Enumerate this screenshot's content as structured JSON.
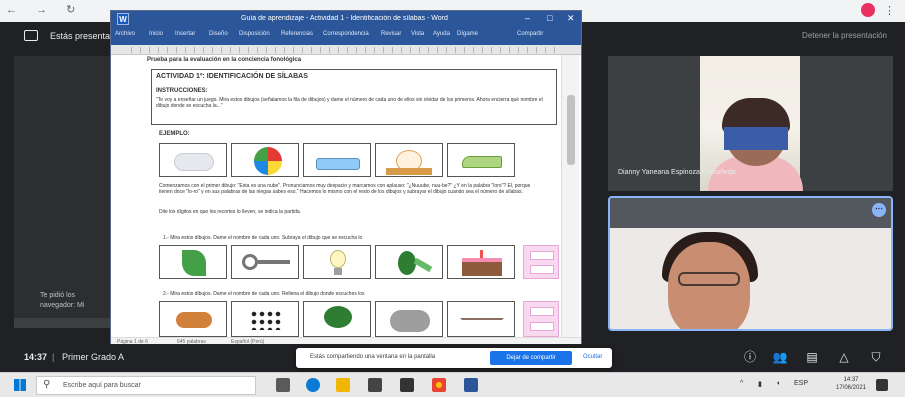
{
  "browser": {
    "nav_glyphs": "← → ↻",
    "menu_glyph": "⋮"
  },
  "meet_header": {
    "presenting_text": "Estás presentando",
    "stop_text": "Detener la presentación"
  },
  "left_captions": {
    "line1": "Te pidió los",
    "line2": "navegador: Mi"
  },
  "word": {
    "logo": "W",
    "title": "Guía de aprendizaje - Actividad 1 - Identificación de sílabas - Word",
    "ribbon_tabs": [
      "Archivo",
      "Inicio",
      "Insertar",
      "Diseño",
      "Disposición",
      "Referencias",
      "Correspondencia",
      "Revisar",
      "Vista",
      "Ayuda",
      "Dígame",
      "Compartir"
    ],
    "doc": {
      "heading": "Prueba para la evaluación en la conciencia fonológica",
      "activity_title": "ACTIVIDAD 1º: IDENTIFICACIÓN DE SÍLABAS",
      "instructions_label": "INSTRUCCIONES:",
      "instructions_text": "\"Te voy a enseñar un juego. Mira estos dibujos (señalamos la fila de dibujos) y dame el número de cada uno de ellos sin olvidar de los primeros. Ahora encierra qué nombre el dibujo donde se escucha la...\"",
      "example_label": "EJEMPLO:",
      "para1": "Comenzamos con el primer dibujo: \"Esta es una nube\". Pronunciamos muy despacio y marcamos con aplauso: \"¿Nuuube, nuu-be?\" ¿Y en la palabra \"loro\"? Él, porque tienen doce \"lo-ro\" y en sus palabras de las niegas sabes eso.\" Hacemos lo mismo con el resto de los dibujos y subrayar el dibujo cuando sea el número de sílabas.",
      "para2": "Dile los dígitos en que los recortes lo lleven, se indica la partida.",
      "q1": "1.- Mira estos dibujos. Dame el nombre de cada uno. Subraya el dibujo que se escucha lo",
      "q2": "2.- Mira estos dibujos. Dame el nombre de cada uno. Rellena el dibujo donde escuches los"
    },
    "status": {
      "page": "Página 1 de 6",
      "words": "645 palabras",
      "lang": "Español (Perú)"
    }
  },
  "tiles": {
    "participant1_name": "Dianny Yaneana Espinoza Castañeda"
  },
  "meet_bar": {
    "time": "14:37",
    "separator": "|",
    "meeting_name": "Primer Grado A"
  },
  "notification": {
    "message": "Estás compartiendo una ventana en la pantalla",
    "stop_button": "Dejar de compartir",
    "hide_button": "Ocultar"
  },
  "taskbar": {
    "search_placeholder": "Escribe aquí para buscar",
    "tray_lang": "ESP",
    "time": "14:37",
    "date": "17/06/2021"
  },
  "colors": {
    "word_blue": "#2b579a",
    "meet_bg": "#202124",
    "accent_blue": "#1a73e8",
    "tile_border": "#8ab4f8"
  }
}
